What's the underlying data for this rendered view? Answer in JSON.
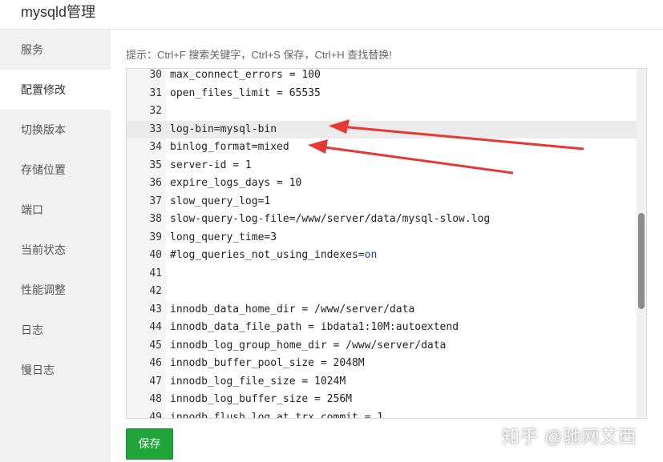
{
  "window": {
    "title": "mysqld管理"
  },
  "sidebar": {
    "items": [
      {
        "label": "服务"
      },
      {
        "label": "配置修改",
        "active": true
      },
      {
        "label": "切换版本"
      },
      {
        "label": "存储位置"
      },
      {
        "label": "端口"
      },
      {
        "label": "当前状态"
      },
      {
        "label": "性能调整"
      },
      {
        "label": "日志"
      },
      {
        "label": "慢日志"
      }
    ]
  },
  "main": {
    "hint": "提示：Ctrl+F 搜索关键字，Ctrl+S 保存，Ctrl+H 查找替换!",
    "save_label": "保存"
  },
  "editor": {
    "highlighted_line": 33,
    "lines": [
      {
        "num": "30",
        "text": "max_connect_errors = 100"
      },
      {
        "num": "31",
        "text": "open_files_limit = 65535"
      },
      {
        "num": "32",
        "text": ""
      },
      {
        "num": "33",
        "text": "log-bin=mysql-bin"
      },
      {
        "num": "34",
        "text": "binlog_format=mixed"
      },
      {
        "num": "35",
        "text": "server-id = 1"
      },
      {
        "num": "36",
        "text": "expire_logs_days = 10"
      },
      {
        "num": "37",
        "text": "slow_query_log=1"
      },
      {
        "num": "38",
        "text": "slow-query-log-file=/www/server/data/mysql-slow.log"
      },
      {
        "num": "39",
        "text": "long_query_time=3"
      },
      {
        "num": "40",
        "text": "#log_queries_not_using_indexes=",
        "kw": "on"
      },
      {
        "num": "41",
        "text": ""
      },
      {
        "num": "42",
        "text": ""
      },
      {
        "num": "43",
        "text": "innodb_data_home_dir = /www/server/data"
      },
      {
        "num": "44",
        "text": "innodb_data_file_path = ibdata1:10M:autoextend"
      },
      {
        "num": "45",
        "text": "innodb_log_group_home_dir = /www/server/data"
      },
      {
        "num": "46",
        "text": "innodb_buffer_pool_size = 2048M"
      },
      {
        "num": "47",
        "text": "innodb_log_file_size = 1024M"
      },
      {
        "num": "48",
        "text": "innodb_log_buffer_size = 256M"
      },
      {
        "num": "49",
        "text": "innodb_flush_log_at_trx_commit = 1"
      }
    ]
  },
  "annotations": {
    "arrow_color": "#e53935"
  },
  "watermark": "知乎 @驰网艾西"
}
